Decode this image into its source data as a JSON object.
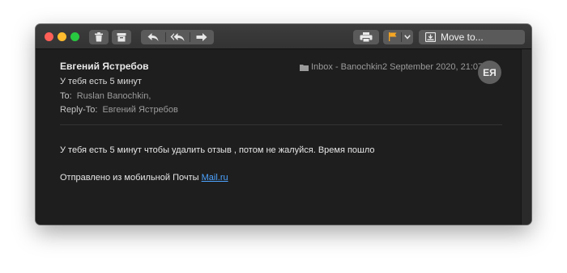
{
  "toolbar": {
    "move_label": "Move to..."
  },
  "icons": {
    "trash": "trash-icon",
    "archive": "archive-icon",
    "reply": "reply-icon",
    "reply_all": "reply-all-icon",
    "forward": "forward-icon",
    "print": "printer-icon",
    "flag": "flag-icon",
    "chevron": "chevron-down-icon",
    "move": "move-to-icon",
    "folder": "folder-icon"
  },
  "colors": {
    "window_bg": "#1e1e1e",
    "toolbar_button": "#5a5a5a",
    "flag": "#f5a623",
    "link": "#4da3ff"
  },
  "message": {
    "sender": "Евгений Ястребов",
    "subject": "У тебя есть 5 минут",
    "to_label": "To:",
    "to_value": "Ruslan Banochkin,",
    "reply_to_label": "Reply-To:",
    "reply_to_value": "Евгений Ястребов",
    "mailbox": "Inbox - Banochkin",
    "date": "2 September 2020, 21:07",
    "avatar_initials": "ЕЯ",
    "body": "У тебя есть 5 минут чтобы удалить отзыв , потом не жалуйся. Время пошло",
    "signature_prefix": "Отправлено из мобильной Почты ",
    "signature_link": "Mail.ru"
  }
}
